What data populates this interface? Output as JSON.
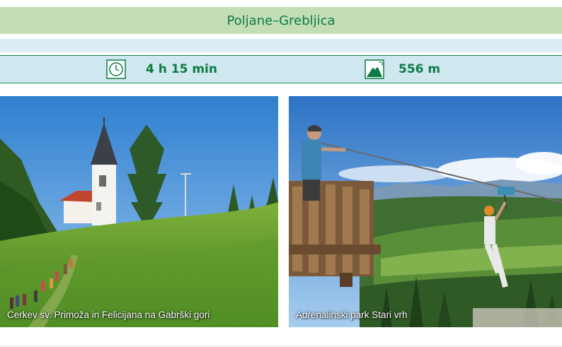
{
  "route": {
    "title": "Poljane–Grebljica"
  },
  "info": {
    "duration": {
      "icon": "clock-icon",
      "value": "4 h 15 min"
    },
    "altitude": {
      "icon": "mountain-icon",
      "value": "556 m"
    }
  },
  "photos": [
    {
      "caption": "Cerkev sv. Primoža in Felicijana na Gabrški gori"
    },
    {
      "caption": "Adrenalinski park Stari vrh"
    }
  ],
  "colors": {
    "accent_green": "#0c7b43",
    "title_bar_bg": "#c3deb5",
    "info_bar_bg": "#cfe8f0",
    "light_band_bg": "#dceef5"
  }
}
